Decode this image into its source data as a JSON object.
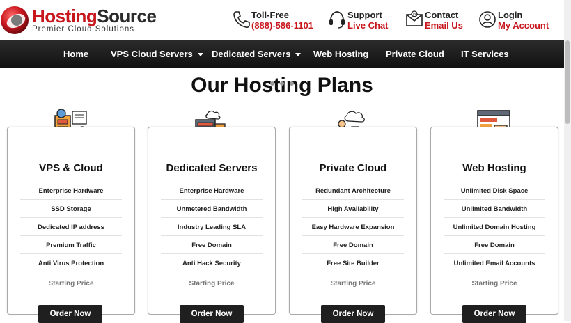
{
  "brand": {
    "name_a": "Hosting",
    "name_b": "Source",
    "tagline": "Premier Cloud Solutions"
  },
  "header_links": [
    {
      "icon": "phone-icon",
      "line1": "Toll-Free",
      "line2": "(888)-586-1101"
    },
    {
      "icon": "headset-icon",
      "line1": "Support",
      "line2": "Live Chat"
    },
    {
      "icon": "envelope-icon",
      "line1": "Contact",
      "line2": "Email Us"
    },
    {
      "icon": "user-icon",
      "line1": "Login",
      "line2": "My Account"
    }
  ],
  "nav": [
    {
      "label": "Home",
      "dropdown": false
    },
    {
      "label": "VPS Cloud Servers",
      "dropdown": true
    },
    {
      "label": "Dedicated Servers",
      "dropdown": true
    },
    {
      "label": "Web Hosting",
      "dropdown": false
    },
    {
      "label": "Private Cloud",
      "dropdown": false
    },
    {
      "label": "IT Services",
      "dropdown": false
    }
  ],
  "main": {
    "title": "Our Hosting Plans"
  },
  "plans": [
    {
      "title": "VPS & Cloud",
      "icon": "server-gear-icon",
      "features": [
        "Enterprise Hardware",
        "SSD Storage",
        "Dedicated IP address",
        "Premium Traffic",
        "Anti Virus Protection"
      ],
      "price_label": "Starting Price",
      "button": "Order Now"
    },
    {
      "title": "Dedicated Servers",
      "icon": "server-rack-icon",
      "features": [
        "Enterprise Hardware",
        "Unmetered Bandwidth",
        "Industry Leading SLA",
        "Free Domain",
        "Anti Hack Security"
      ],
      "price_label": "Starting Price",
      "button": "Order Now"
    },
    {
      "title": "Private Cloud",
      "icon": "cloud-user-icon",
      "features": [
        "Redundant Architecture",
        "High Availability",
        "Easy Hardware Expansion",
        "Free Domain",
        "Free Site Builder"
      ],
      "price_label": "Starting Price",
      "button": "Order Now"
    },
    {
      "title": "Web Hosting",
      "icon": "web-browser-icon",
      "features": [
        "Unlimited Disk Space",
        "Unlimited Bandwidth",
        "Unlimited Domain Hosting",
        "Free Domain",
        "Unlimited Email Accounts"
      ],
      "price_label": "Starting Price",
      "button": "Order Now"
    }
  ],
  "colors": {
    "accent": "#c8161d",
    "nav_bg": "#1a1a1a",
    "button_bg": "#1f1f1f"
  }
}
